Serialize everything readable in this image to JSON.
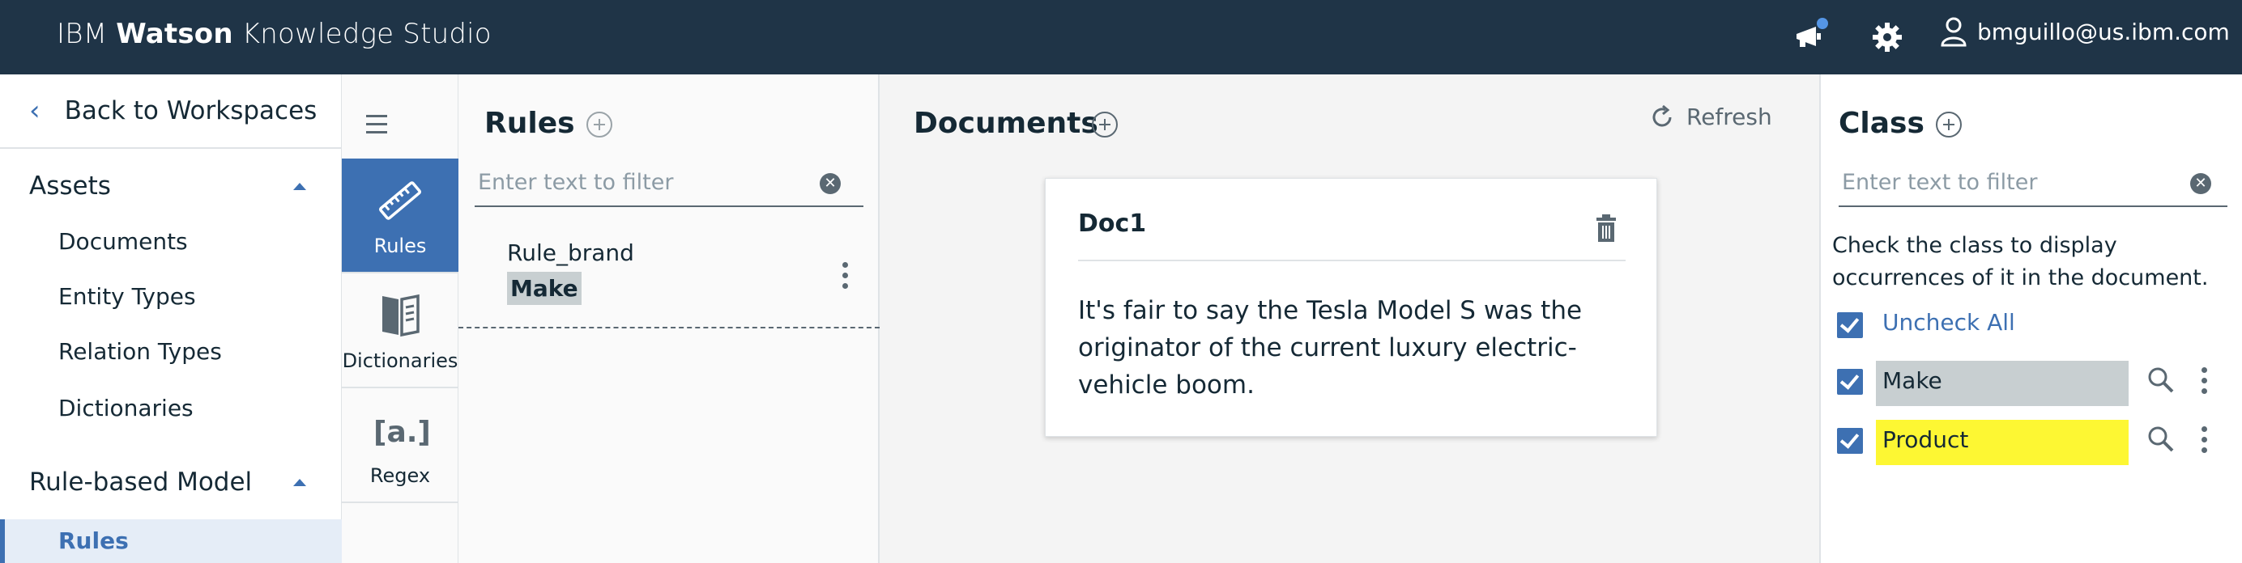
{
  "header": {
    "brand_prefix": "IBM",
    "brand_bold": "Watson",
    "brand_suffix": "Knowledge Studio",
    "user_email": "bmguillo@us.ibm.com"
  },
  "leftnav": {
    "back_label": "Back to Workspaces",
    "assets_label": "Assets",
    "assets_items": [
      "Documents",
      "Entity Types",
      "Relation Types",
      "Dictionaries"
    ],
    "model_label": "Rule-based Model",
    "active_item": "Rules"
  },
  "rail": {
    "tools": [
      "Rules",
      "Dictionaries",
      "Regex"
    ]
  },
  "rules_panel": {
    "title": "Rules",
    "filter_placeholder": "Enter text to filter",
    "rule": {
      "name": "Rule_brand",
      "tag": "Make"
    }
  },
  "documents_panel": {
    "title": "Documents",
    "refresh_label": "Refresh",
    "doc": {
      "name": "Doc1",
      "text": "It's fair to say the Tesla Model S was the originator of the current luxury electric-vehicle boom."
    }
  },
  "class_panel": {
    "title": "Class",
    "filter_placeholder": "Enter text to filter",
    "instructions": "Check the class to display occurrences of it in the document.",
    "uncheck_all": "Uncheck All",
    "classes": [
      {
        "name": "Make",
        "color": "#c8cfd1"
      },
      {
        "name": "Product",
        "color": "#fdf733"
      }
    ]
  },
  "colors": {
    "topbar": "#1f3447",
    "accent": "#3d70b2",
    "notification_dot": "#5596e6"
  }
}
